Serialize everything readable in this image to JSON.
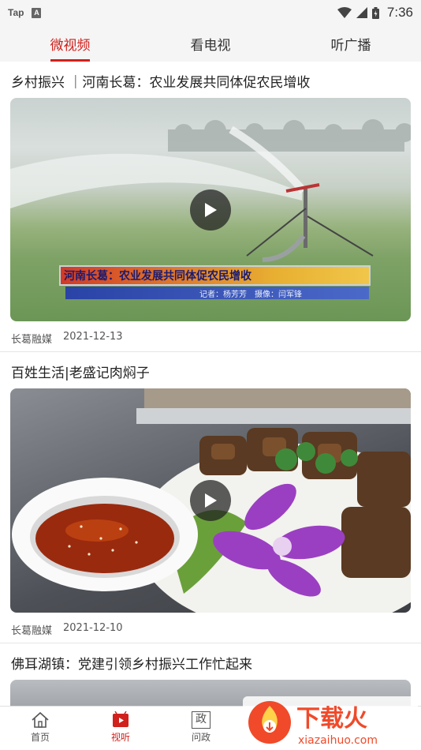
{
  "status_bar": {
    "app_label": "Tap",
    "a_icon_letter": "A",
    "time": "7:36"
  },
  "tabs": [
    {
      "label": "微视频",
      "active": true
    },
    {
      "label": "看电视",
      "active": false
    },
    {
      "label": "听广播",
      "active": false
    }
  ],
  "articles": [
    {
      "title": "乡村振兴 ｜河南长葛：农业发展共同体促农民增收",
      "source": "长葛融媒",
      "date": "2021-12-13",
      "overlay_title": "河南长葛：农业发展共同体促农民增收",
      "overlay_sub": "记者：杨芳芳　摄像：闫军锋"
    },
    {
      "title": "百姓生活|老盛记肉焖子",
      "source": "长葛融媒",
      "date": "2021-12-10"
    },
    {
      "title": "佛耳湖镇：党建引领乡村振兴工作忙起来"
    }
  ],
  "bottom_nav": [
    {
      "label": "首页",
      "icon": "home-icon",
      "active": false
    },
    {
      "label": "视听",
      "icon": "video-icon",
      "active": true
    },
    {
      "label": "问政",
      "icon": "zheng-icon",
      "icon_char": "政",
      "active": false
    }
  ],
  "watermark": {
    "brand": "下载火",
    "url": "xiazaihuo.com"
  },
  "colors": {
    "accent": "#d0211c",
    "status_bg": "#f5f5f5"
  }
}
